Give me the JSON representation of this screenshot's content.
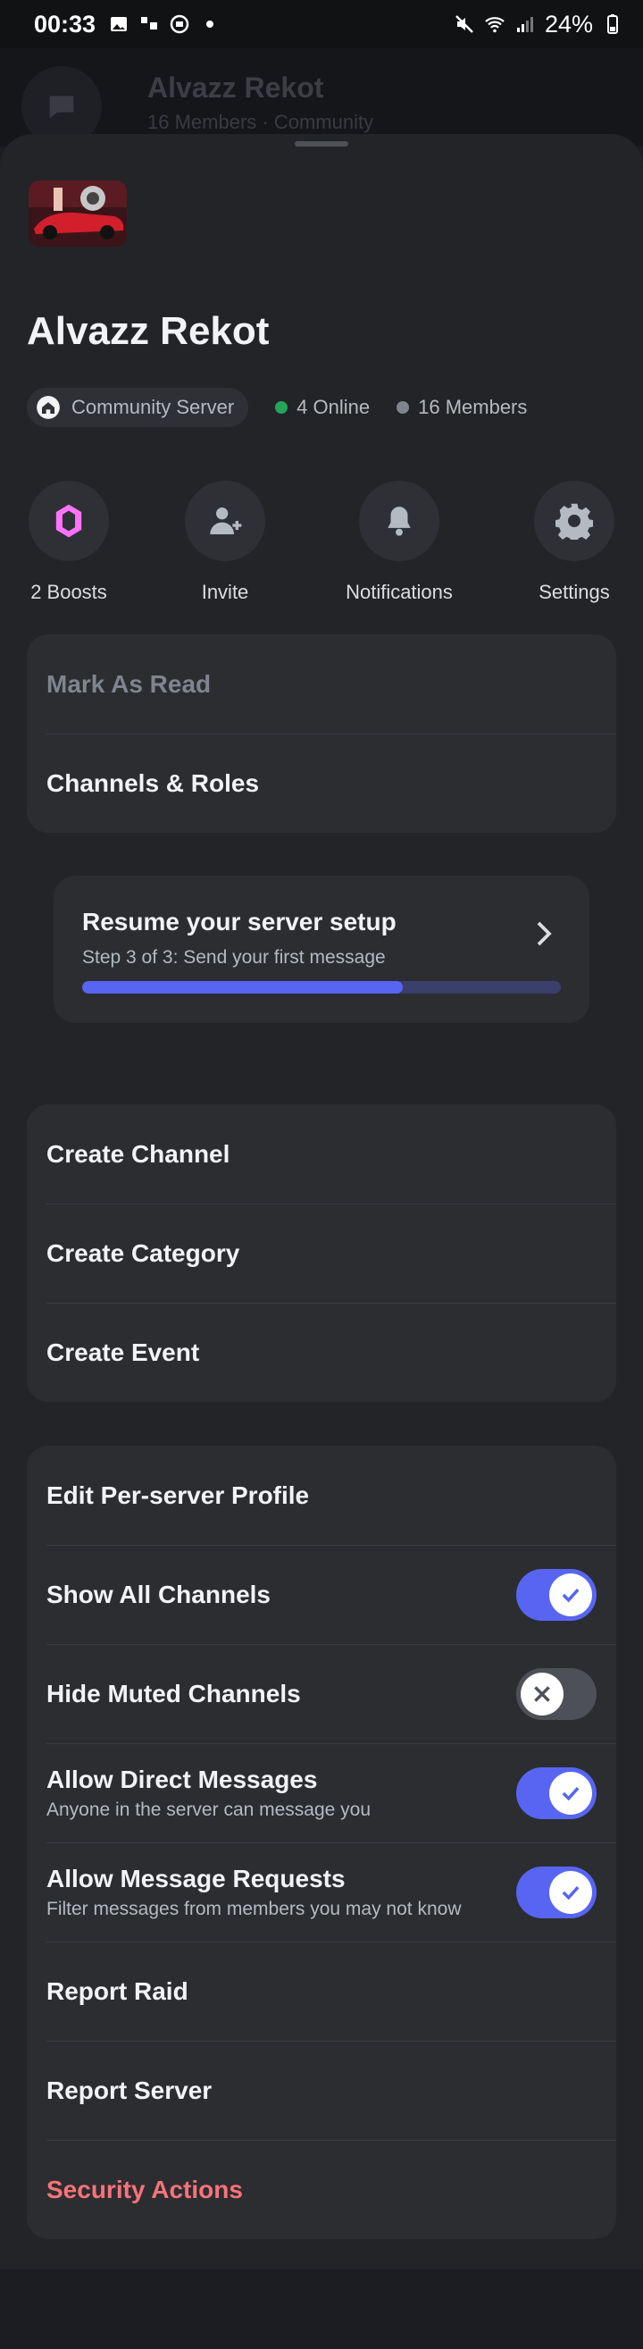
{
  "status_bar": {
    "time": "00:33",
    "battery": "24%"
  },
  "background_header": {
    "title": "Alvazz Rekot",
    "subtitle": "16 Members  ·  Community"
  },
  "server": {
    "name": "Alvazz Rekot",
    "community_label": "Community Server",
    "online": "4 Online",
    "members": "16 Members"
  },
  "actions": [
    {
      "label": "2 Boosts",
      "icon": "boost-gem-icon"
    },
    {
      "label": "Invite",
      "icon": "add-person-icon"
    },
    {
      "label": "Notifications",
      "icon": "bell-icon"
    },
    {
      "label": "Settings",
      "icon": "gear-icon"
    }
  ],
  "menu1": {
    "mark_as_read": "Mark As Read",
    "channels_roles": "Channels & Roles"
  },
  "setup": {
    "title": "Resume your server setup",
    "subtitle": "Step 3 of 3: Send your first message",
    "progress": 0.67
  },
  "menu2": {
    "create_channel": "Create Channel",
    "create_category": "Create Category",
    "create_event": "Create Event"
  },
  "menu3": {
    "edit_profile": "Edit Per-server Profile",
    "show_all_channels": "Show All Channels",
    "hide_muted": "Hide Muted Channels",
    "allow_dm": "Allow Direct Messages",
    "allow_dm_sub": "Anyone in the server can message you",
    "allow_requests": "Allow Message Requests",
    "allow_requests_sub": "Filter messages from members you may not know",
    "report_raid": "Report Raid",
    "report_server": "Report Server",
    "security_actions": "Security Actions"
  },
  "toggles": {
    "show_all_channels": true,
    "hide_muted": false,
    "allow_dm": true,
    "allow_requests": true
  },
  "colors": {
    "accent": "#5865f2",
    "online": "#23a55a",
    "danger": "#f87379"
  }
}
